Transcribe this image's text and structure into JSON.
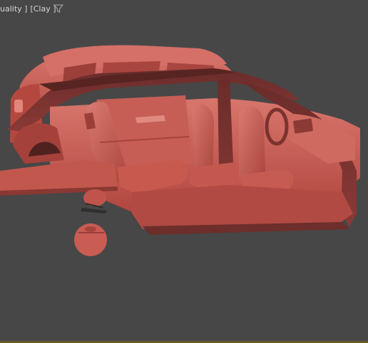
{
  "viewport": {
    "quality_label": "uality ]",
    "shading_label": "[Clay ]",
    "filter_icon": "funnel-icon",
    "shading_mode": "Clay",
    "colors": {
      "background": "#474747",
      "clay": "#c8564e",
      "clay_dark": "#7a3633",
      "clay_light": "#d86a60"
    }
  }
}
